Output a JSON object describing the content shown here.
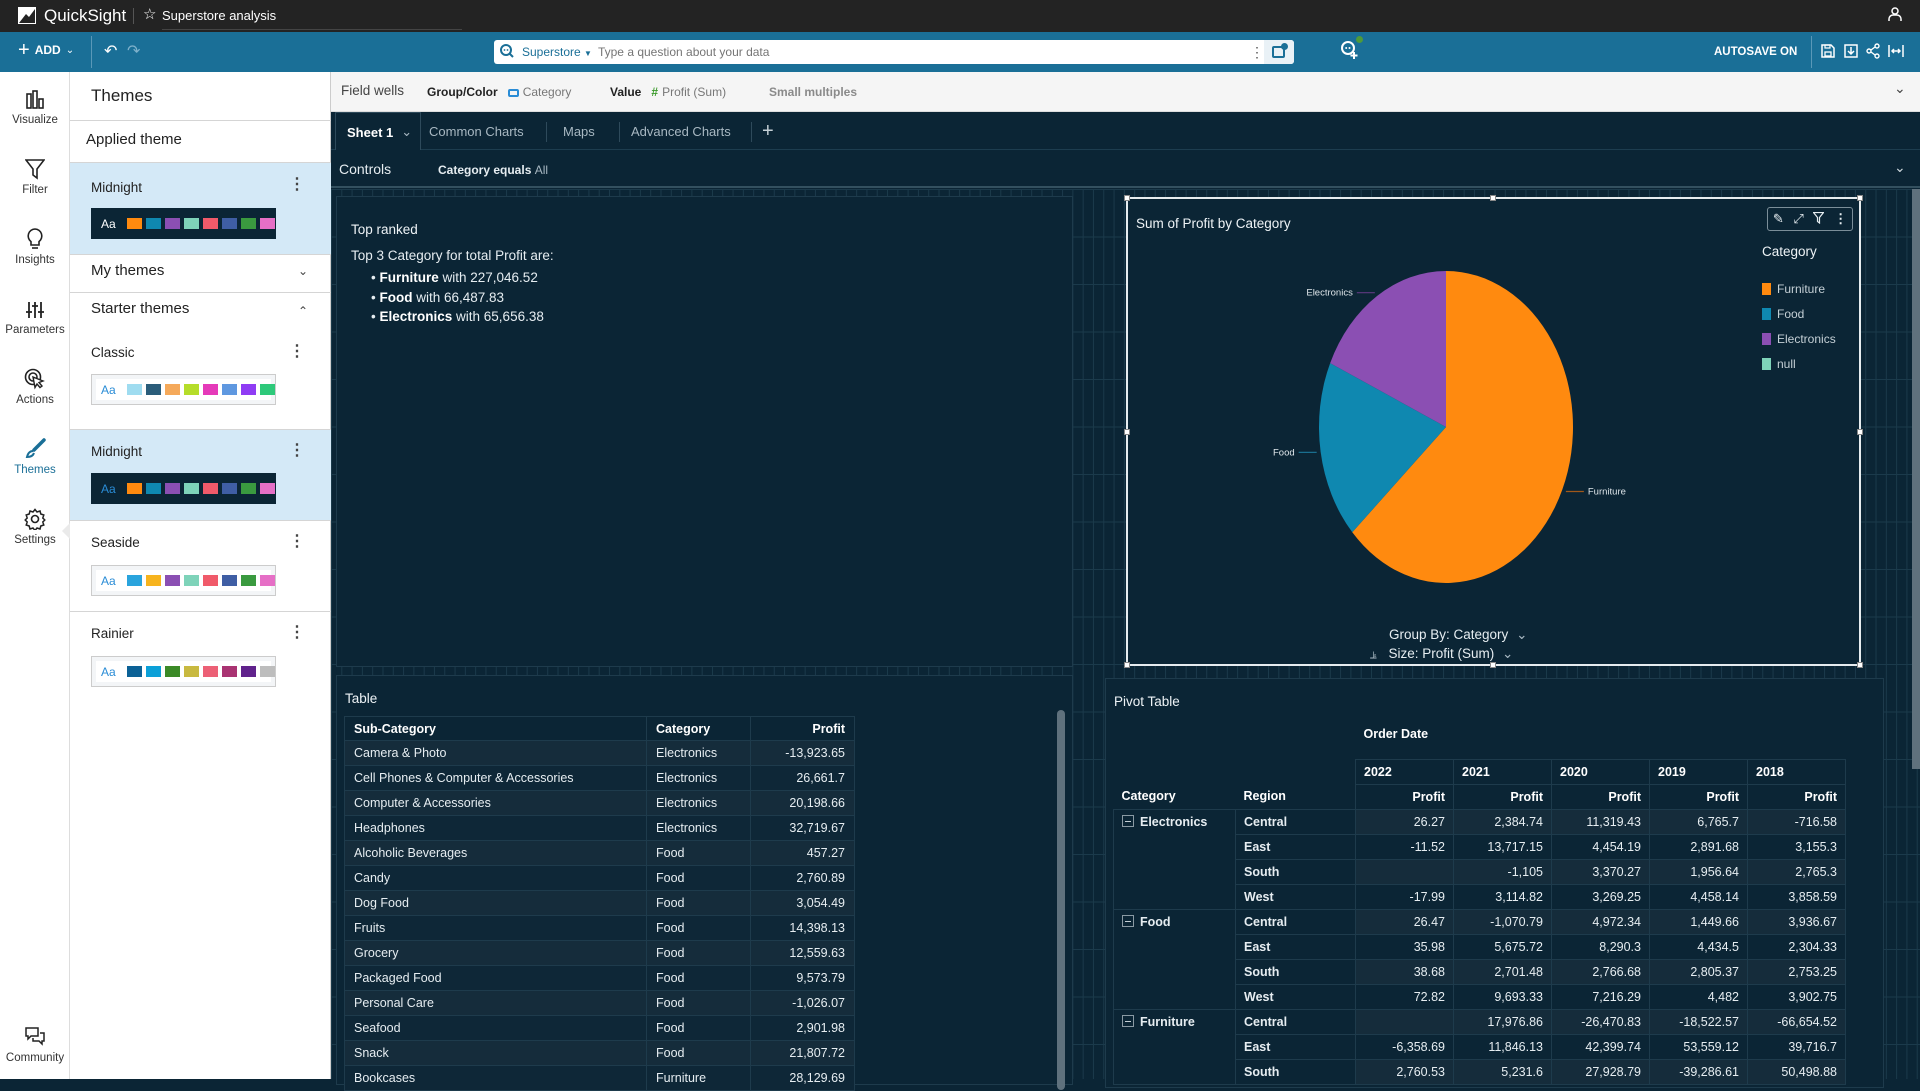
{
  "topbar": {
    "app_name": "QuickSight",
    "analysis_title": "Superstore analysis"
  },
  "toolbar": {
    "add_label": "ADD",
    "search": {
      "dataset": "Superstore",
      "placeholder": "Type a question about your data"
    },
    "autosave_label": "AUTOSAVE ON"
  },
  "rail": {
    "items": [
      {
        "label": "Visualize",
        "icon": "bar-chart-icon"
      },
      {
        "label": "Filter",
        "icon": "filter-icon"
      },
      {
        "label": "Insights",
        "icon": "lightbulb-icon"
      },
      {
        "label": "Parameters",
        "icon": "sliders-icon"
      },
      {
        "label": "Actions",
        "icon": "cursor-click-icon"
      },
      {
        "label": "Themes",
        "icon": "brush-icon",
        "active": true
      },
      {
        "label": "Settings",
        "icon": "gear-icon"
      },
      {
        "label": "Community",
        "icon": "chat-bubbles-icon"
      }
    ]
  },
  "themes_panel": {
    "title": "Themes",
    "applied_header": "Applied theme",
    "applied": {
      "name": "Midnight"
    },
    "my_themes_label": "My themes",
    "starter_themes_label": "Starter themes",
    "swatch_text": "Aa",
    "palettes": {
      "midnight": [
        "#ff8a0f",
        "#0f88b0",
        "#8b4fb3",
        "#7ed3b9",
        "#f05a6a",
        "#3f5ea4",
        "#3a9a3f",
        "#e66fc6"
      ],
      "classic": [
        "#9fdcf0",
        "#2b5d7a",
        "#f5a95a",
        "#b5dd2a",
        "#e53ab9",
        "#5f98e0",
        "#8f3cf4",
        "#2ec97a"
      ],
      "seaside": [
        "#2aa4dd",
        "#f7b41e",
        "#8b4fb3",
        "#7ed3b9",
        "#f05a6a",
        "#3f5ea4",
        "#3a9a3f",
        "#e66fc6"
      ],
      "rainier": [
        "#0b6196",
        "#0ba0d8",
        "#3b8a27",
        "#c8b940",
        "#ec6076",
        "#a93372",
        "#60228c",
        "#bdbdbd"
      ]
    },
    "starter": [
      {
        "name": "Classic",
        "palette": "classic"
      },
      {
        "name": "Midnight",
        "palette": "midnight",
        "selected": true
      },
      {
        "name": "Seaside",
        "palette": "seaside"
      },
      {
        "name": "Rainier",
        "palette": "rainier"
      }
    ]
  },
  "field_wells": {
    "label": "Field wells",
    "group_color_label": "Group/Color",
    "group_color_field": "Category",
    "value_label": "Value",
    "value_field": "Profit (Sum)",
    "small_multiples_label": "Small multiples"
  },
  "sheets": {
    "tabs": [
      "Sheet 1",
      "Common Charts",
      "Maps",
      "Advanced Charts"
    ],
    "active": "Sheet 1"
  },
  "controls": {
    "label": "Controls",
    "filter_label": "Category equals",
    "filter_value": "All"
  },
  "insight": {
    "title": "Top ranked",
    "intro": "Top 3 Category for total Profit are:",
    "items": [
      {
        "name": "Furniture",
        "text": "with 227,046.52"
      },
      {
        "name": "Food",
        "text": "with 66,487.83"
      },
      {
        "name": "Electronics",
        "text": "with 65,656.38"
      }
    ]
  },
  "chart_data": {
    "type": "pie",
    "title": "Sum of Profit by Category",
    "legend_title": "Category",
    "legend_position": "top-right",
    "categories": [
      "Furniture",
      "Food",
      "Electronics",
      "null"
    ],
    "values": [
      227046.52,
      66487.83,
      65656.38,
      0
    ],
    "colors": [
      "#ff8a0f",
      "#0f88b0",
      "#8b4fb3",
      "#7ed3b9"
    ],
    "group_by_label": "Group By: Category",
    "size_label": "Size: Profit (Sum)"
  },
  "table": {
    "title": "Table",
    "columns": [
      "Sub-Category",
      "Category",
      "Profit"
    ],
    "rows": [
      [
        "Camera & Photo",
        "Electronics",
        "-13,923.65"
      ],
      [
        "Cell Phones & Computer & Accessories",
        "Electronics",
        "26,661.7"
      ],
      [
        "Computer & Accessories",
        "Electronics",
        "20,198.66"
      ],
      [
        "Headphones",
        "Electronics",
        "32,719.67"
      ],
      [
        "Alcoholic Beverages",
        "Food",
        "457.27"
      ],
      [
        "Candy",
        "Food",
        "2,760.89"
      ],
      [
        "Dog Food",
        "Food",
        "3,054.49"
      ],
      [
        "Fruits",
        "Food",
        "14,398.13"
      ],
      [
        "Grocery",
        "Food",
        "12,559.63"
      ],
      [
        "Packaged Food",
        "Food",
        "9,573.79"
      ],
      [
        "Personal Care",
        "Food",
        "-1,026.07"
      ],
      [
        "Seafood",
        "Food",
        "2,901.98"
      ],
      [
        "Snack",
        "Food",
        "21,807.72"
      ],
      [
        "Bookcases",
        "Furniture",
        "28,129.69"
      ]
    ]
  },
  "pivot": {
    "title": "Pivot Table",
    "column_header": "Order Date",
    "row_headers": [
      "Category",
      "Region"
    ],
    "years": [
      "2022",
      "2021",
      "2020",
      "2019",
      "2018"
    ],
    "measure": "Profit",
    "groups": [
      {
        "category": "Electronics",
        "rows": [
          {
            "region": "Central",
            "values": [
              "26.27",
              "2,384.74",
              "11,319.43",
              "6,765.7",
              "-716.58"
            ]
          },
          {
            "region": "East",
            "values": [
              "-11.52",
              "13,717.15",
              "4,454.19",
              "2,891.68",
              "3,155.3"
            ]
          },
          {
            "region": "South",
            "values": [
              "",
              "-1,105",
              "3,370.27",
              "1,956.64",
              "2,765.3"
            ]
          },
          {
            "region": "West",
            "values": [
              "-17.99",
              "3,114.82",
              "3,269.25",
              "4,458.14",
              "3,858.59"
            ]
          }
        ]
      },
      {
        "category": "Food",
        "rows": [
          {
            "region": "Central",
            "values": [
              "26.47",
              "-1,070.79",
              "4,972.34",
              "1,449.66",
              "3,936.67"
            ]
          },
          {
            "region": "East",
            "values": [
              "35.98",
              "5,675.72",
              "8,290.3",
              "4,434.5",
              "2,304.33"
            ]
          },
          {
            "region": "South",
            "values": [
              "38.68",
              "2,701.48",
              "2,766.68",
              "2,805.37",
              "2,753.25"
            ]
          },
          {
            "region": "West",
            "values": [
              "72.82",
              "9,693.33",
              "7,216.29",
              "4,482",
              "3,902.75"
            ]
          }
        ]
      },
      {
        "category": "Furniture",
        "rows": [
          {
            "region": "Central",
            "values": [
              "",
              "17,976.86",
              "-26,470.83",
              "-18,522.57",
              "-66,654.52"
            ]
          },
          {
            "region": "East",
            "values": [
              "-6,358.69",
              "11,846.13",
              "42,399.74",
              "53,559.12",
              "39,716.7"
            ]
          },
          {
            "region": "South",
            "values": [
              "2,760.53",
              "5,231.6",
              "27,928.79",
              "-39,286.61",
              "50,498.88"
            ]
          }
        ]
      }
    ]
  }
}
